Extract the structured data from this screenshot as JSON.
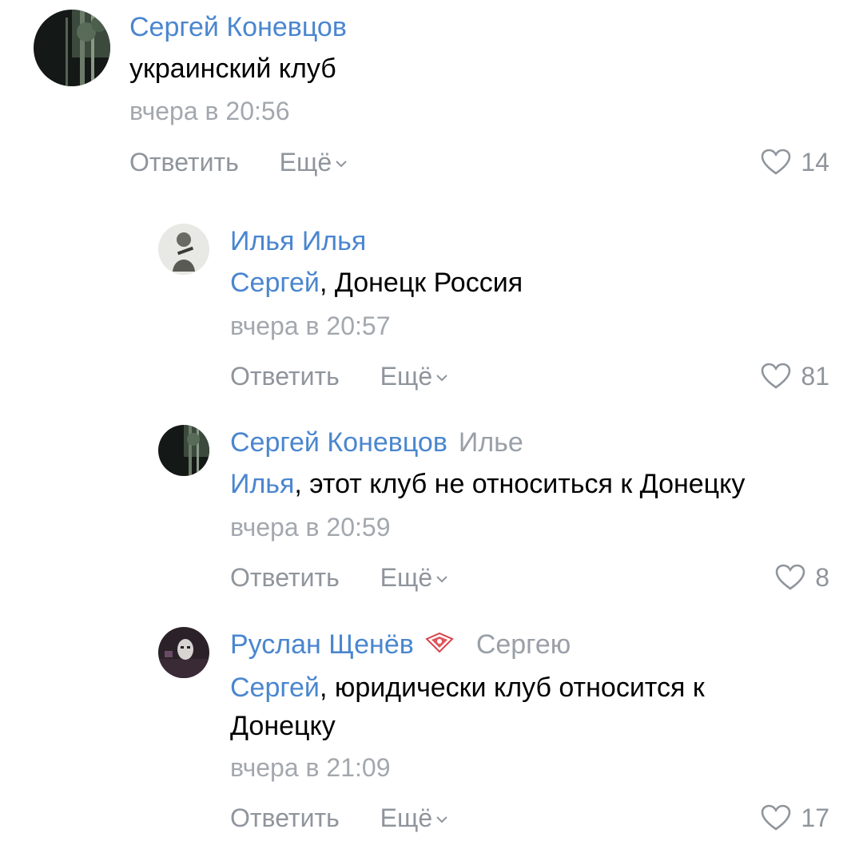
{
  "comments": [
    {
      "author": "Сергей Коневцов",
      "reply_to": "",
      "mention": "",
      "text": "украинский клуб",
      "date": "вчера в 20:56",
      "reply_label": "Ответить",
      "more_label": "Ещё",
      "likes": "14"
    },
    {
      "author": "Илья Илья",
      "reply_to": "",
      "mention": "Сергей",
      "text": ", Донецк Россия",
      "date": "вчера в 20:57",
      "reply_label": "Ответить",
      "more_label": "Ещё",
      "likes": "81"
    },
    {
      "author": "Сергей Коневцов",
      "reply_to": "Илье",
      "mention": "Илья",
      "text": ", этот клуб не относиться к Донецку",
      "date": "вчера в 20:59",
      "reply_label": "Ответить",
      "more_label": "Ещё",
      "likes": "8"
    },
    {
      "author": "Руслан Щенёв",
      "reply_to": "Сергею",
      "mention": "Сергей",
      "text": ", юридически клуб относится к Донецку",
      "date": "вчера в 21:09",
      "reply_label": "Ответить",
      "more_label": "Ещё",
      "likes": "17",
      "badge_icon": "spartak-badge-icon"
    }
  ],
  "colors": {
    "link": "#4a86cf",
    "secondary": "#a3a8ae",
    "text": "#000000"
  }
}
